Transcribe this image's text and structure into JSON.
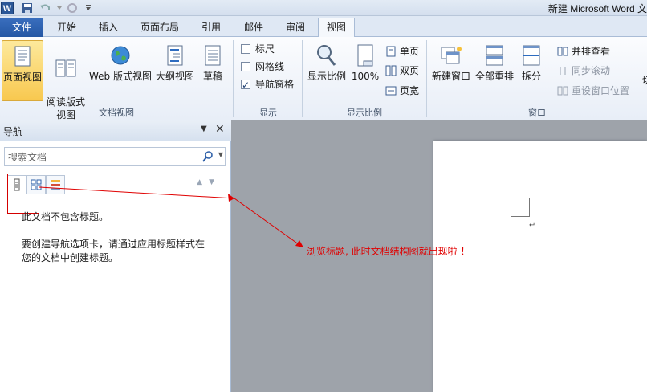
{
  "window": {
    "app_icon": "W",
    "title": "新建 Microsoft Word 文"
  },
  "tabs": {
    "file": "文件",
    "items": [
      "开始",
      "插入",
      "页面布局",
      "引用",
      "邮件",
      "审阅",
      "视图"
    ],
    "active": "视图"
  },
  "ribbon": {
    "document_views": {
      "label": "文档视图",
      "buttons": [
        "页面视图",
        "阅读版式\n视图",
        "Web 版式视图",
        "大纲视图",
        "草稿"
      ]
    },
    "show": {
      "label": "显示",
      "ruler": "标尺",
      "gridlines": "网格线",
      "nav_pane": "导航窗格"
    },
    "zoom": {
      "label": "显示比例",
      "zoom": "显示比例",
      "hundred": "100%",
      "one_page": "单页",
      "two_pages": "双页",
      "page_width": "页宽"
    },
    "window": {
      "label": "窗口",
      "new_window": "新建窗口",
      "arrange_all": "全部重排",
      "split": "拆分",
      "side_by_side": "并排查看",
      "sync_scroll": "同步滚动",
      "reset_position": "重设窗口位置",
      "switch_partial": "切"
    }
  },
  "nav_pane": {
    "title": "导航",
    "search_placeholder": "搜索文档",
    "message_line1": "此文档不包含标题。",
    "message_line2": "要创建导航选项卡，请通过应用标题样式在",
    "message_line3": "您的文档中创建标题。"
  },
  "document": {
    "para_mark": "↵"
  },
  "annotation": {
    "text": "浏览标题, 此时文档结构图就出现啦 ！"
  },
  "colors": {
    "annotation_red": "#e00000",
    "file_tab_blue": "#2457a4",
    "selected_button": "#f8c84f"
  }
}
